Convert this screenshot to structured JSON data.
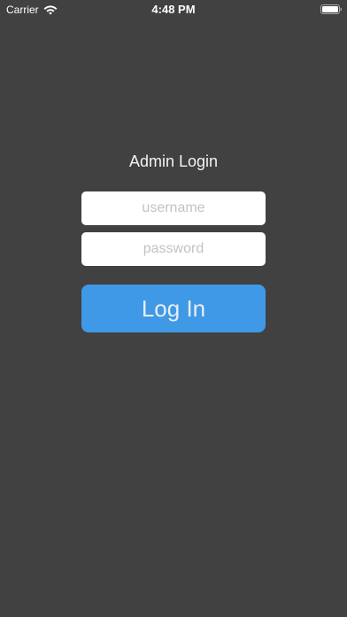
{
  "status_bar": {
    "carrier": "Carrier",
    "time": "4:48 PM",
    "wifi_icon": "wifi-icon",
    "battery_icon": "battery-icon"
  },
  "login": {
    "title": "Admin Login",
    "username_placeholder": "username",
    "username_value": "",
    "password_placeholder": "password",
    "password_value": "",
    "submit_label": "Log In"
  },
  "colors": {
    "background": "#414141",
    "button": "#3f99e6",
    "field": "#ffffff",
    "placeholder": "#c3c3c3"
  }
}
